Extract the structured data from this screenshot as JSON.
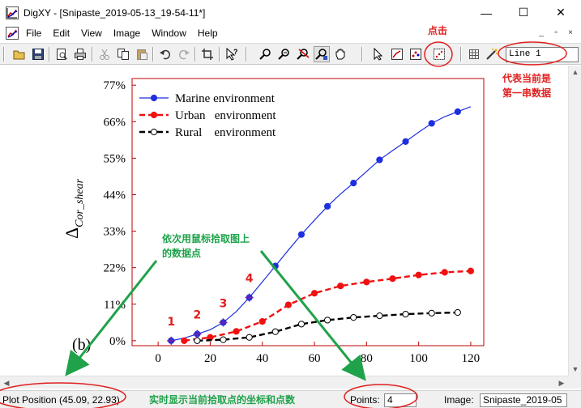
{
  "window": {
    "title": "DigXY - [Snipaste_2019-05-13_19-54-11*]",
    "min_glyph": "—",
    "max_glyph": "☐",
    "close_glyph": "✕",
    "mdi_min": "_",
    "mdi_restore": "▫",
    "mdi_close": "×"
  },
  "menu": [
    "File",
    "Edit",
    "View",
    "Image",
    "Window",
    "Help"
  ],
  "toolbar": {
    "icons": [
      "open-icon",
      "save-icon",
      "print-preview-icon",
      "print-icon",
      "cut-icon",
      "copy-icon",
      "paste-icon",
      "undo-icon",
      "redo-icon",
      "crop-icon",
      "help-pointer-icon",
      "zoom-in-icon",
      "zoom-out-icon",
      "zoom-clear-icon",
      "pick-point-icon",
      "hand-icon",
      "select-icon",
      "axis-icon",
      "point-grid-icon",
      "digitize-icon",
      "table-icon",
      "wand-icon"
    ],
    "line_select": "Line 1"
  },
  "chart_data": {
    "type": "line",
    "panel_label": "(b)",
    "ylabel": "Δ",
    "ylabel_subscript": "Cor_shear",
    "xlim": [
      -10,
      125
    ],
    "ylim": [
      -0.015,
      0.79
    ],
    "x_ticks": [
      0,
      20,
      40,
      60,
      80,
      100,
      120
    ],
    "y_ticks": [
      0,
      0.11,
      0.22,
      0.33,
      0.44,
      0.55,
      0.66,
      0.77
    ],
    "y_tick_labels": [
      "0%",
      "11%",
      "22%",
      "33%",
      "44%",
      "55%",
      "66%",
      "77%"
    ],
    "legend_position": "top-left",
    "series": [
      {
        "name": "Marine environment",
        "color": "#1e2fe0",
        "marker": "filled",
        "dash": "solid",
        "x": [
          5,
          15,
          25,
          35,
          45,
          55,
          65,
          75,
          85,
          95,
          105,
          115
        ],
        "y": [
          0.0,
          0.02,
          0.055,
          0.13,
          0.225,
          0.32,
          0.405,
          0.475,
          0.545,
          0.6,
          0.655,
          0.69
        ],
        "curve_x": [
          5,
          10,
          15,
          20,
          25,
          30,
          35,
          40,
          45,
          50,
          55,
          60,
          65,
          70,
          75,
          80,
          85,
          90,
          95,
          100,
          105,
          110,
          115,
          120
        ],
        "curve_y": [
          0.0,
          0.008,
          0.02,
          0.033,
          0.055,
          0.088,
          0.13,
          0.177,
          0.225,
          0.273,
          0.32,
          0.363,
          0.405,
          0.442,
          0.475,
          0.51,
          0.545,
          0.573,
          0.6,
          0.628,
          0.655,
          0.675,
          0.69,
          0.705
        ]
      },
      {
        "name": "Urban   environment",
        "color": "#f01010",
        "marker": "filled",
        "dash": "dashed",
        "x": [
          10,
          20,
          30,
          40,
          50,
          60,
          70,
          80,
          90,
          100,
          110,
          120
        ],
        "y": [
          0.0,
          0.01,
          0.028,
          0.058,
          0.108,
          0.143,
          0.165,
          0.177,
          0.187,
          0.198,
          0.206,
          0.21
        ]
      },
      {
        "name": "Rural    environment",
        "color": "#000000",
        "marker": "hollow",
        "dash": "dashed",
        "x": [
          15,
          25,
          35,
          45,
          55,
          65,
          75,
          85,
          95,
          105,
          115
        ],
        "y": [
          0.0,
          0.003,
          0.01,
          0.027,
          0.05,
          0.062,
          0.07,
          0.075,
          0.08,
          0.083,
          0.085
        ]
      }
    ],
    "picked_points": {
      "x": [
        5,
        15,
        25,
        35
      ],
      "y": [
        0.0,
        0.02,
        0.055,
        0.13
      ],
      "labels": [
        "1",
        "2",
        "3",
        "4"
      ]
    }
  },
  "annotations": {
    "click_label": "点击",
    "line_note_1": "代表当前是",
    "line_note_2": "第一串数据",
    "pick_note_1": "依次用鼠标拾取图上",
    "pick_note_2": "的数据点",
    "status_note": "实时显示当前拾取点的坐标和点数",
    "red_color": "#e02020",
    "green_color": "#1fa24a"
  },
  "status": {
    "plot_position": "Plot Position (45.09, 22.93)",
    "points_label": "Points:",
    "points_value": "4",
    "image_label": "Image:",
    "image_value": "Snipaste_2019-05"
  }
}
